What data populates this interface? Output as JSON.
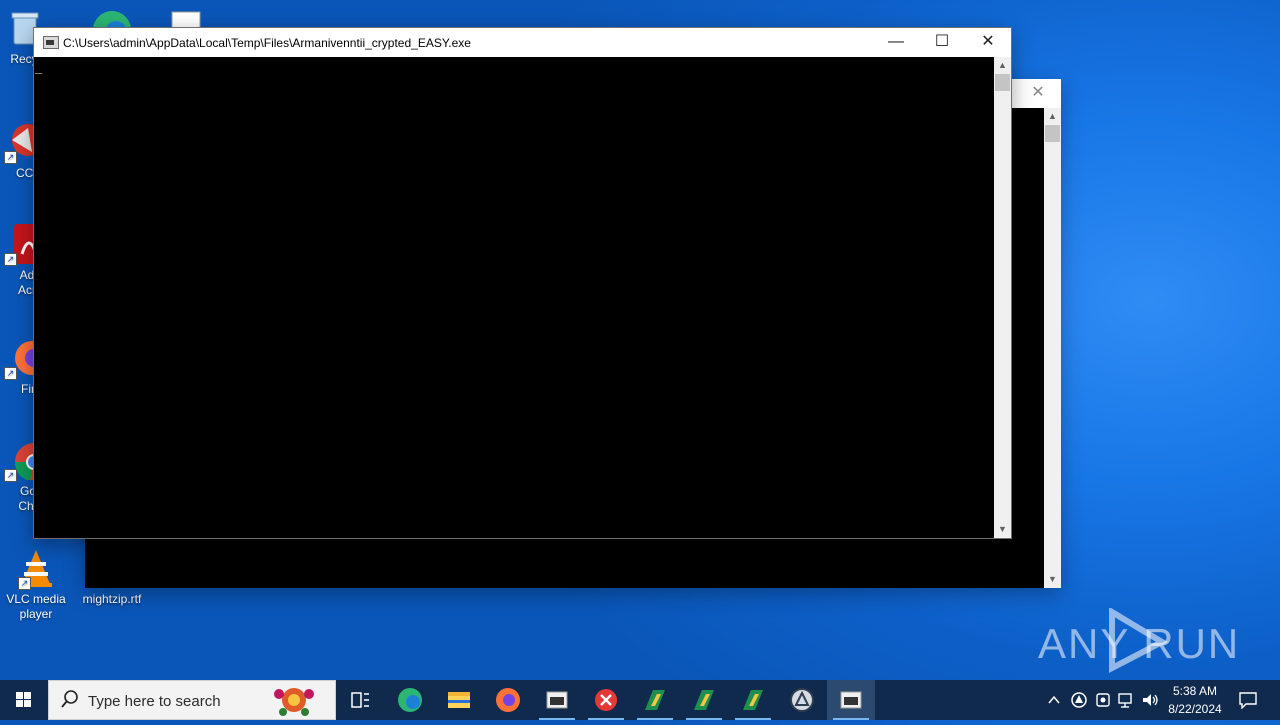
{
  "desktop": {
    "icons": [
      {
        "label": "Recy",
        "icon": "recycle-bin-icon"
      },
      {
        "label": "CCl",
        "icon": "ccleaner-icon"
      },
      {
        "label": "Ad Acr",
        "icon": "acrobat-icon"
      },
      {
        "label": "Fir",
        "icon": "firefox-icon"
      },
      {
        "label": "Go Chr",
        "icon": "chrome-icon"
      },
      {
        "label": "VLC media player",
        "icon": "vlc-icon"
      },
      {
        "label": "mightzip.rtf",
        "icon": "rtf-file-icon"
      }
    ],
    "watermark": "ANY RUN"
  },
  "windows": {
    "front": {
      "title": "C:\\Users\\admin\\AppData\\Local\\Temp\\Files\\Armanivenntii_crypted_EASY.exe",
      "cursor": "_"
    }
  },
  "taskbar": {
    "search_placeholder": "Type here to search",
    "apps": [
      "task-view-icon",
      "edge-icon",
      "file-explorer-icon",
      "firefox-icon",
      "console-icon",
      "error-x-icon",
      "winrar-icon",
      "winrar-icon",
      "winrar-icon",
      "anyrun-icon",
      "console-active-icon"
    ],
    "clock": {
      "time": "5:38 AM",
      "date": "8/22/2024"
    }
  },
  "colors": {
    "console_bg": "#000000",
    "taskbar_bg": "#0f2a4d",
    "desktop_blue": "#1877e6"
  }
}
